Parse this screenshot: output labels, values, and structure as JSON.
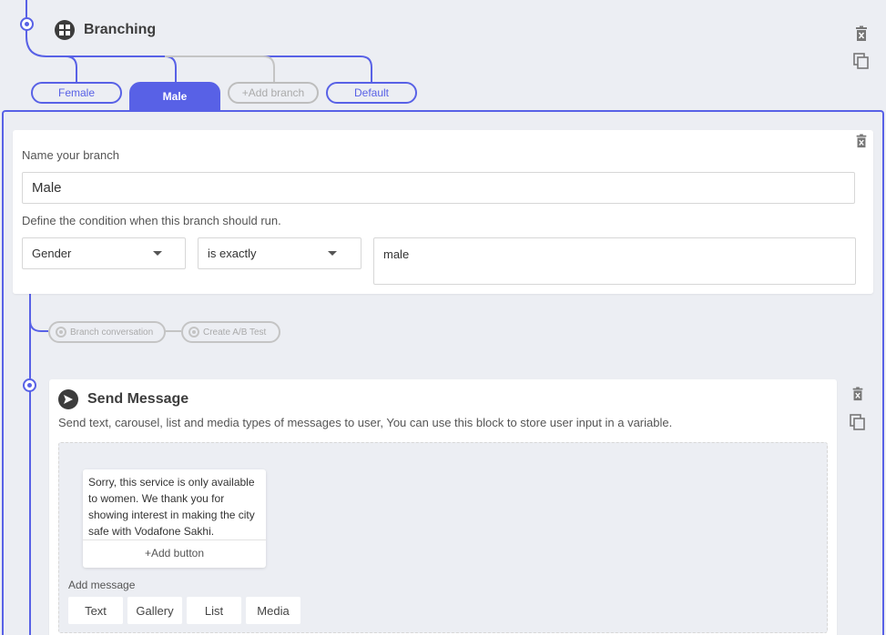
{
  "branching": {
    "title": "Branching",
    "icon": "grid-icon"
  },
  "tabs": [
    {
      "label": "Female",
      "active": false
    },
    {
      "label": "Male",
      "active": true
    },
    {
      "label": "+Add branch",
      "active": false
    },
    {
      "label": "Default",
      "active": false
    }
  ],
  "branch_form": {
    "name_label": "Name your branch",
    "name_value": "Male",
    "condition_label": "Define the condition when this branch should run.",
    "field_value": "Gender",
    "operator_value": "is exactly",
    "match_value": "male"
  },
  "actions": {
    "branch_conversation": "Branch conversation",
    "create_ab_test": "Create A/B Test"
  },
  "send_message": {
    "title": "Send Message",
    "description": "Send text, carousel, list and media types of messages to user, You can use this block to store user input in a variable.",
    "bubble_text": "Sorry, this service is only available to women. We thank you for showing interest in making the city safe with Vodafone Sakhi.",
    "add_button": "+Add button",
    "add_message_label": "Add message",
    "types": [
      "Text",
      "Gallery",
      "List",
      "Media"
    ]
  },
  "colors": {
    "accent": "#5861e6",
    "background": "#eceef3",
    "muted": "#c4c4c4"
  }
}
